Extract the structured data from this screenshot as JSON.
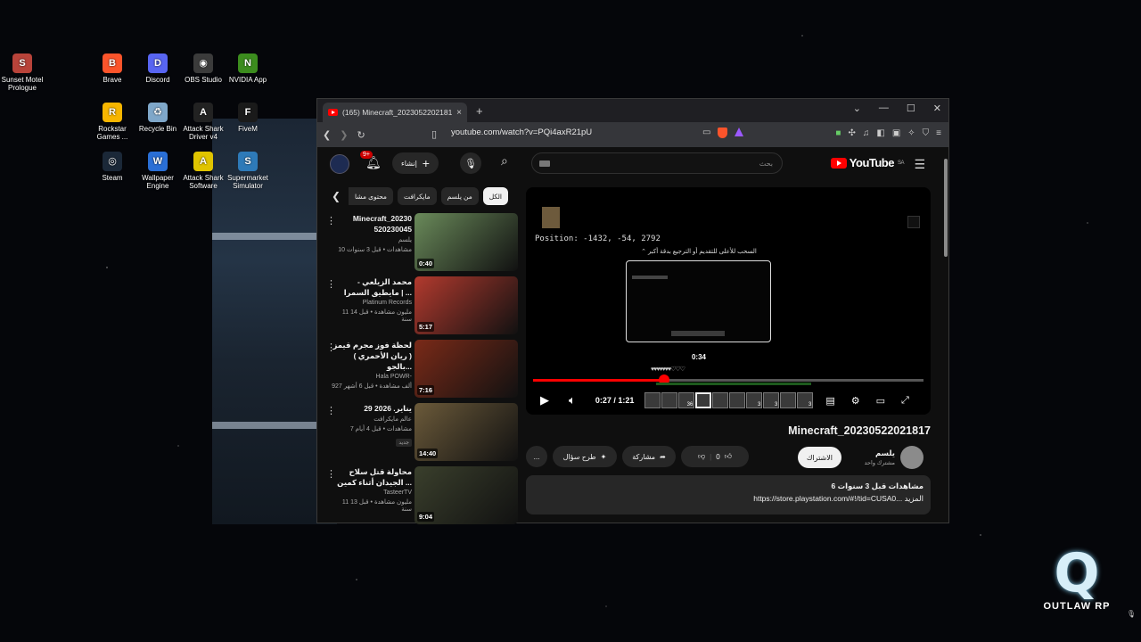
{
  "desktop": {
    "icons": [
      {
        "label": "Sunset Motel Prologue",
        "icon": "sunset-motel-icon",
        "color": "#b8433a"
      },
      {
        "label": "Brave",
        "icon": "brave-icon",
        "color": "#fb542b"
      },
      {
        "label": "Discord",
        "icon": "discord-icon",
        "color": "#5865f2"
      },
      {
        "label": "OBS Studio",
        "icon": "obs-icon",
        "color": "#3b3b3b"
      },
      {
        "label": "NVIDIA App",
        "icon": "nvidia-icon",
        "color": "#3c8c1e"
      },
      {
        "label": "Rockstar Games ...",
        "icon": "rockstar-icon",
        "color": "#f7b500"
      },
      {
        "label": "Recycle Bin",
        "icon": "recycle-bin-icon",
        "color": "#7fa7c9"
      },
      {
        "label": "Attack Shark Driver v4",
        "icon": "attack-shark-driver-icon",
        "color": "#222222"
      },
      {
        "label": "FiveM",
        "icon": "fivem-icon",
        "color": "#1a1a1a"
      },
      {
        "label": "Steam",
        "icon": "steam-icon",
        "color": "#1b2838"
      },
      {
        "label": "Wallpaper Engine",
        "icon": "wallpaper-engine-icon",
        "color": "#2a6fd6"
      },
      {
        "label": "Attack Shark Software",
        "icon": "attack-shark-software-icon",
        "color": "#e0c400"
      },
      {
        "label": "Supermarket Simulator",
        "icon": "supermarket-simulator-icon",
        "color": "#2e7ab8"
      }
    ]
  },
  "browser": {
    "tab_title": "(165) Minecraft_2023052202181",
    "tab_close": "×",
    "new_tab": "+",
    "url": "youtube.com/watch?v=PQi4axR21pU",
    "brave_badge": "43",
    "window_controls": [
      "⌄",
      "—",
      "☐",
      "✕"
    ]
  },
  "youtube": {
    "search_placeholder": "بحث",
    "create_label": "إنشاء",
    "notif_badge": "9+",
    "logo_text": "YouTube",
    "logo_region": "SA",
    "chips": [
      "الكل",
      "من يلسم",
      "مايكرافت",
      "محتوى مشا"
    ],
    "recommendations": [
      {
        "title": "Minecraft_20230 520230045",
        "channel": "يلسم",
        "meta": "10 مشاهدات • قبل 3 سنوات",
        "duration": "0:40",
        "badge": "",
        "thumb": "#6a8a5a"
      },
      {
        "title": "محمد الزيلعي - مايطيق السمرا | ...",
        "channel": "Platinum Records",
        "meta": "11 مليون مشاهدة • قبل 14 سنة",
        "duration": "5:17",
        "badge": "",
        "thumb": "#b23a2e"
      },
      {
        "title": "لحظة فوز مجرم قيمز ( ريان الأحمري ) بالجو...",
        "channel": "Hala POWR-",
        "meta": "927 ألف مشاهدة • قبل 6 أشهر",
        "duration": "7:16",
        "badge": "",
        "thumb": "#7a2a18"
      },
      {
        "title": "29 يناير. 2026",
        "channel": "عالم مايكرافت",
        "meta": "7 مشاهدات • قبل 4 أيام",
        "duration": "14:40",
        "badge": "جديد",
        "thumb": "#6b5a3a"
      },
      {
        "title": "محاولة قتل سلاح الجيدان أثناء كمين ...",
        "channel": "TasteerTV",
        "meta": "11 مليون مشاهدة • قبل 13 سنة",
        "duration": "9:04",
        "badge": "",
        "thumb": "#3a3f2c"
      }
    ],
    "player": {
      "position_text": "Position: -1432, -54, 2792",
      "drag_hint": "السحب للأعلى للتقديم أو الترجيع بدقة أكبر",
      "preview_time": "0:34",
      "current_time": "0:27 / 1:21",
      "progress_fraction": 0.336,
      "hotbar_counts": [
        "",
        "",
        "36",
        "",
        "",
        "",
        "3",
        "3",
        "",
        "3"
      ]
    },
    "video_title": "Minecraft_20230522021817",
    "channel_name": "يلسم",
    "channel_subs": "مشترك واحد",
    "subscribe_label": "الاشتراك",
    "like_count": "0",
    "share_label": "مشاركة",
    "ask_label": "طرح سؤال",
    "more_label": "...",
    "description_meta": "6 مشاهدات  قبل 3 سنوات",
    "description_text": "https://store.playstation.com/#!/tid=CUSA0... المزيد"
  },
  "overlay": {
    "brand_mark": "Q",
    "brand_name": "OUTLAW RP"
  },
  "colors": {
    "yt_red": "#ff0000",
    "yt_bg": "#0f0f0f",
    "chip_bg": "#272727"
  }
}
